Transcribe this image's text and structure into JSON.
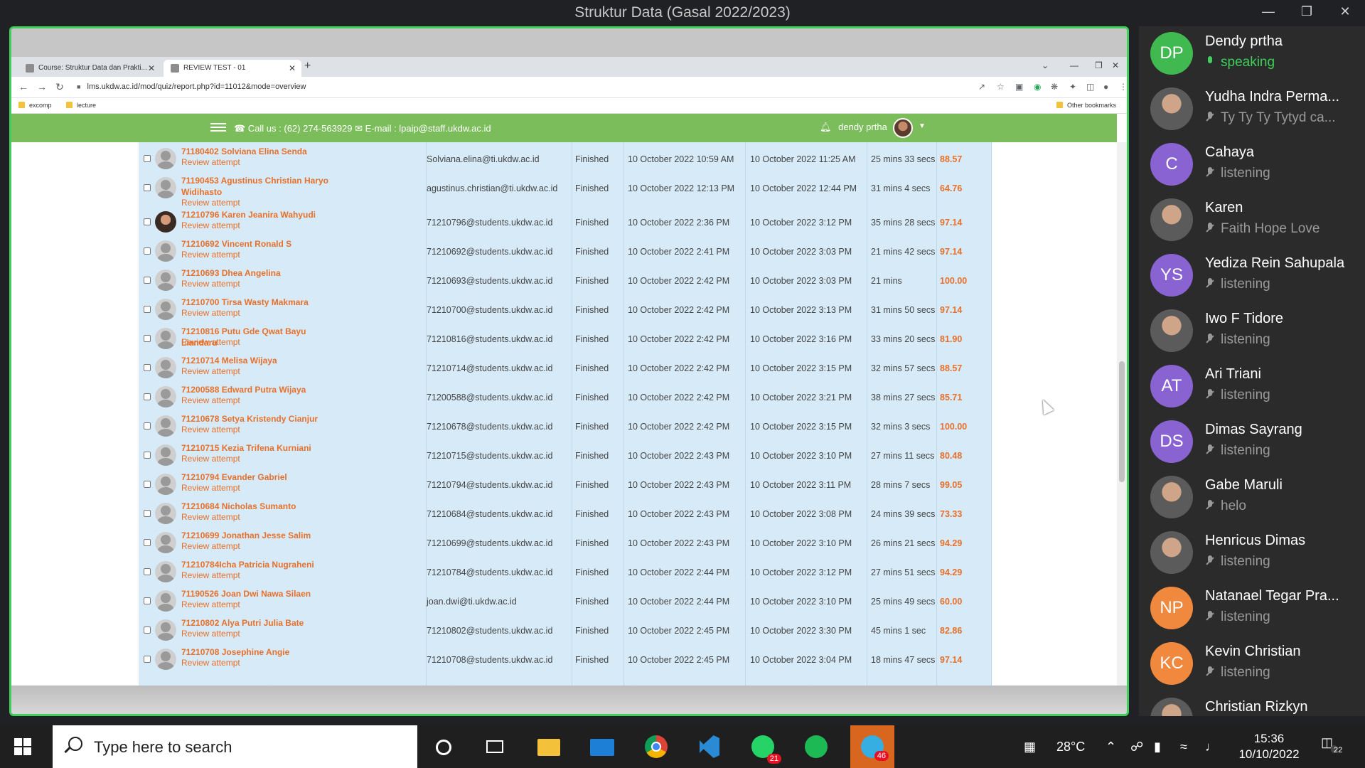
{
  "window": {
    "title": "Struktur Data (Gasal 2022/2023)"
  },
  "browser": {
    "tabs": [
      {
        "label": "Course: Struktur Data dan Prakti..."
      },
      {
        "label": "REVIEW TEST - 01"
      }
    ],
    "url": "lms.ukdw.ac.id/mod/quiz/report.php?id=11012&mode=overview",
    "bookmarks": [
      "excomp",
      "lecture"
    ],
    "other_bookmarks": "Other bookmarks"
  },
  "site": {
    "contact": "☎ Call us : (62) 274-563929 ✉ E-mail : lpaip@staff.ukdw.ac.id",
    "user": "dendy prtha"
  },
  "attempts": {
    "review_label": "Review attempt",
    "rows": [
      {
        "name": "71180402 Solviana Elina Senda",
        "email": "Solviana.elina@ti.ukdw.ac.id",
        "state": "Finished",
        "started": "10 October 2022 10:59 AM",
        "completed": "10 October 2022 11:25 AM",
        "duration": "25 mins 33 secs",
        "grade": "88.57"
      },
      {
        "name": "71190453 Agustinus Christian Haryo Widihasto",
        "email": "agustinus.christian@ti.ukdw.ac.id",
        "state": "Finished",
        "started": "10 October 2022 12:13 PM",
        "completed": "10 October 2022 12:44 PM",
        "duration": "31 mins 4 secs",
        "grade": "64.76"
      },
      {
        "name": "71210796 Karen Jeanira Wahyudi",
        "email": "71210796@students.ukdw.ac.id",
        "state": "Finished",
        "started": "10 October 2022 2:36 PM",
        "completed": "10 October 2022 3:12 PM",
        "duration": "35 mins 28 secs",
        "grade": "97.14"
      },
      {
        "name": "71210692 Vincent Ronald S",
        "email": "71210692@students.ukdw.ac.id",
        "state": "Finished",
        "started": "10 October 2022 2:41 PM",
        "completed": "10 October 2022 3:03 PM",
        "duration": "21 mins 42 secs",
        "grade": "97.14"
      },
      {
        "name": "71210693 Dhea Angelina",
        "email": "71210693@students.ukdw.ac.id",
        "state": "Finished",
        "started": "10 October 2022 2:42 PM",
        "completed": "10 October 2022 3:03 PM",
        "duration": "21 mins",
        "grade": "100.00"
      },
      {
        "name": "71210700 Tirsa Wasty Makmara",
        "email": "71210700@students.ukdw.ac.id",
        "state": "Finished",
        "started": "10 October 2022 2:42 PM",
        "completed": "10 October 2022 3:13 PM",
        "duration": "31 mins 50 secs",
        "grade": "97.14"
      },
      {
        "name": "71210816 Putu Gde Qwat Bayu Liandaru",
        "email": "71210816@students.ukdw.ac.id",
        "state": "Finished",
        "started": "10 October 2022 2:42 PM",
        "completed": "10 October 2022 3:16 PM",
        "duration": "33 mins 20 secs",
        "grade": "81.90"
      },
      {
        "name": "71210714 Melisa Wijaya",
        "email": "71210714@students.ukdw.ac.id",
        "state": "Finished",
        "started": "10 October 2022 2:42 PM",
        "completed": "10 October 2022 3:15 PM",
        "duration": "32 mins 57 secs",
        "grade": "88.57"
      },
      {
        "name": "71200588 Edward Putra Wijaya",
        "email": "71200588@students.ukdw.ac.id",
        "state": "Finished",
        "started": "10 October 2022 2:42 PM",
        "completed": "10 October 2022 3:21 PM",
        "duration": "38 mins 27 secs",
        "grade": "85.71"
      },
      {
        "name": "71210678 Setya Kristendy Cianjur",
        "email": "71210678@students.ukdw.ac.id",
        "state": "Finished",
        "started": "10 October 2022 2:42 PM",
        "completed": "10 October 2022 3:15 PM",
        "duration": "32 mins 3 secs",
        "grade": "100.00"
      },
      {
        "name": "71210715 Kezia Trifena Kurniani",
        "email": "71210715@students.ukdw.ac.id",
        "state": "Finished",
        "started": "10 October 2022 2:43 PM",
        "completed": "10 October 2022 3:10 PM",
        "duration": "27 mins 11 secs",
        "grade": "80.48"
      },
      {
        "name": "71210794 Evander Gabriel",
        "email": "71210794@students.ukdw.ac.id",
        "state": "Finished",
        "started": "10 October 2022 2:43 PM",
        "completed": "10 October 2022 3:11 PM",
        "duration": "28 mins 7 secs",
        "grade": "99.05"
      },
      {
        "name": "71210684 Nicholas Sumanto",
        "email": "71210684@students.ukdw.ac.id",
        "state": "Finished",
        "started": "10 October 2022 2:43 PM",
        "completed": "10 October 2022 3:08 PM",
        "duration": "24 mins 39 secs",
        "grade": "73.33"
      },
      {
        "name": "71210699 Jonathan Jesse Salim",
        "email": "71210699@students.ukdw.ac.id",
        "state": "Finished",
        "started": "10 October 2022 2:43 PM",
        "completed": "10 October 2022 3:10 PM",
        "duration": "26 mins 21 secs",
        "grade": "94.29"
      },
      {
        "name": "71210784Icha Patricia Nugraheni",
        "email": "71210784@students.ukdw.ac.id",
        "state": "Finished",
        "started": "10 October 2022 2:44 PM",
        "completed": "10 October 2022 3:12 PM",
        "duration": "27 mins 51 secs",
        "grade": "94.29"
      },
      {
        "name": "71190526 Joan Dwi Nawa Silaen",
        "email": "joan.dwi@ti.ukdw.ac.id",
        "state": "Finished",
        "started": "10 October 2022 2:44 PM",
        "completed": "10 October 2022 3:10 PM",
        "duration": "25 mins 49 secs",
        "grade": "60.00"
      },
      {
        "name": "71210802 Alya Putri Julia Bate",
        "email": "71210802@students.ukdw.ac.id",
        "state": "Finished",
        "started": "10 October 2022 2:45 PM",
        "completed": "10 October 2022 3:30 PM",
        "duration": "45 mins 1 sec",
        "grade": "82.86"
      },
      {
        "name": "71210708 Josephine Angie",
        "email": "71210708@students.ukdw.ac.id",
        "state": "Finished",
        "started": "10 October 2022 2:45 PM",
        "completed": "10 October 2022 3:04 PM",
        "duration": "18 mins 47 secs",
        "grade": "97.14"
      }
    ]
  },
  "participants": [
    {
      "initials": "DP",
      "name": "Dendy prtha",
      "status": "speaking",
      "color": "#3fb950",
      "speaking": true
    },
    {
      "initials": "",
      "name": "Yudha Indra Perma...",
      "status": "Ty Ty Ty Tytyd ca...",
      "color": "#555555",
      "photo": true
    },
    {
      "initials": "C",
      "name": "Cahaya",
      "status": "listening",
      "color": "#8a63d2"
    },
    {
      "initials": "",
      "name": "Karen",
      "status": "Faith Hope Love",
      "color": "#555555",
      "photo": true
    },
    {
      "initials": "YS",
      "name": "Yediza Rein Sahupala",
      "status": "listening",
      "color": "#8a63d2"
    },
    {
      "initials": "",
      "name": "Iwo F Tidore",
      "status": "listening",
      "color": "#555555",
      "photo": true
    },
    {
      "initials": "AT",
      "name": "Ari Triani",
      "status": "listening",
      "color": "#8a63d2"
    },
    {
      "initials": "DS",
      "name": "Dimas Sayrang",
      "status": "listening",
      "color": "#8a63d2"
    },
    {
      "initials": "",
      "name": "Gabe Maruli",
      "status": "helo",
      "color": "#555555",
      "photo": true
    },
    {
      "initials": "",
      "name": "Henricus Dimas",
      "status": "listening",
      "color": "#555555",
      "photo": true
    },
    {
      "initials": "NP",
      "name": "Natanael Tegar Pra...",
      "status": "listening",
      "color": "#f0883e"
    },
    {
      "initials": "KC",
      "name": "Kevin Christian",
      "status": "listening",
      "color": "#f0883e"
    },
    {
      "initials": "",
      "name": "Christian Rizkyn",
      "status": "",
      "color": "#555555",
      "photo": true
    }
  ],
  "taskbar": {
    "search_placeholder": "Type here to search",
    "whatsapp_badge": "21",
    "telegram_badge": "46",
    "temperature": "28°C",
    "time": "15:36",
    "date": "10/10/2022",
    "notifications": "22"
  }
}
